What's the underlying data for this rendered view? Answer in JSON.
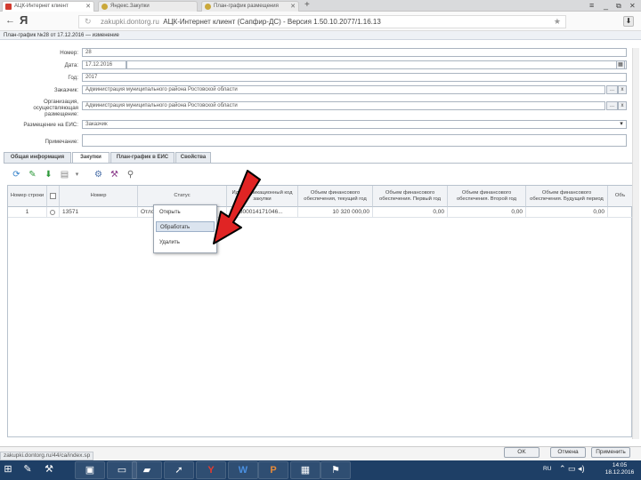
{
  "browser": {
    "tabs": [
      {
        "label": "АЦК-Интернет клиент"
      },
      {
        "label": "Яндекс.Закупки"
      },
      {
        "label": "План-график размещения"
      }
    ],
    "back_glyph": "←",
    "yandex_logo": "Я",
    "url_host": "zakupki.dontorg.ru",
    "url_title": "АЦК-Интернет клиент (Сапфир-ДС) - Версия 1.50.10.2077/1.16.13",
    "window_controls": {
      "menu": "≡",
      "minimize": "_",
      "restore": "⧉",
      "close": "✕"
    }
  },
  "document": {
    "header": "План-график №28 от 17.12.2016 — изменение",
    "fields": [
      {
        "label": "Номер:",
        "value": "28"
      },
      {
        "label": "Дата:",
        "value": "17.12.2016"
      },
      {
        "label": "Год:",
        "value": "2017"
      },
      {
        "label": "Заказчик:",
        "value": "Администрация муниципального района Ростовской области"
      },
      {
        "label": "Организация, осуществляющая размещение:",
        "value": "Администрация муниципального района Ростовской области"
      },
      {
        "label": "Размещение на ЕИС:",
        "value": "Заказчик"
      },
      {
        "label": "Примечание:",
        "value": ""
      }
    ],
    "ellipsis": "...",
    "clear": "x"
  },
  "form_tabs": [
    {
      "label": "Общая информация"
    },
    {
      "label": "Закупки"
    },
    {
      "label": "План-график в ЕИС"
    },
    {
      "label": "Свойства"
    }
  ],
  "grid": {
    "columns": [
      "Номер строки",
      "",
      "Номер",
      "Статус",
      "Идентификационный код закупки",
      "Объем финансового обеспечения, текущий год",
      "Объем финансового обеспечения. Первый год",
      "Объем финансового обеспечения. Второй год",
      "Объем финансового обеспечения. Будущий период",
      "Объ"
    ],
    "rows": [
      [
        "1",
        "",
        "13571",
        "Отложен",
        "172800014171046...",
        "10 320 000,00",
        "0,00",
        "0,00",
        "0,00",
        ""
      ]
    ]
  },
  "context_menu": {
    "items": [
      "Открыть",
      "Обработать",
      "Удалить"
    ],
    "highlighted_index": 1
  },
  "status_url": "zakupki.dontorg.ru/44/ca/index.sp",
  "footer": {
    "ok": "OK",
    "cancel": "Отмена",
    "apply": "Применить"
  },
  "taskbar": {
    "lang": "RU",
    "time": "14:05",
    "date": "18.12.2016"
  },
  "colors": {
    "arrow": "#e02424",
    "taskbar": "#1e3f66",
    "selection": "#dbe4ef"
  }
}
